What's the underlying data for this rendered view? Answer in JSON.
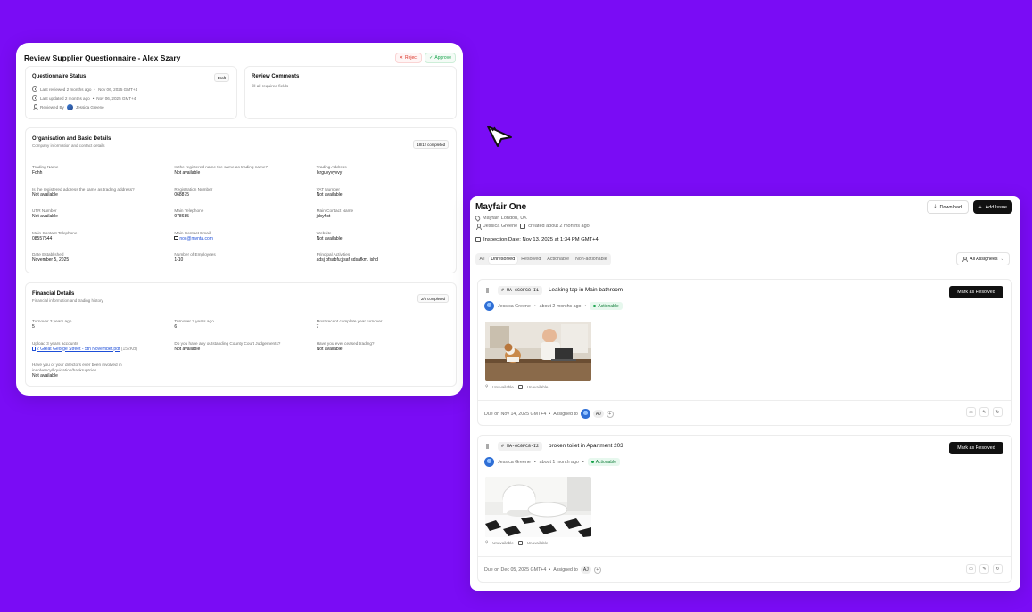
{
  "supplier_review": {
    "title": "Review Supplier Questionnaire - Alex Szary",
    "reject_label": "Reject",
    "approve_label": "Approve",
    "status_card": {
      "title": "Questionnaire Status",
      "badge": "Draft",
      "last_reviewed": "Last reviewed 2 months ago",
      "last_reviewed_date": "Nov 06, 2025 GMT+4",
      "last_updated": "Last updated 2 months ago",
      "last_updated_date": "Nov 06, 2025 GMT+4",
      "reviewed_by_label": "Reviewed By",
      "reviewer": "Jessica Greene"
    },
    "comments_card": {
      "title": "Review Comments",
      "text": "fill all required fields"
    },
    "org_section": {
      "title": "Organisation and Basic Details",
      "subtitle": "Company information and contact details",
      "badge": "18/12 completed",
      "fields": [
        {
          "label": "Trading Name",
          "value": "Fdhh"
        },
        {
          "label": "Is the registered name the same as trading name?",
          "value": "Not available"
        },
        {
          "label": "Trading Address",
          "value": "Ikrguvyvyvvy"
        },
        {
          "label": "Is the registered address the same as trading address?",
          "value": "Not available"
        },
        {
          "label": "Registration Number",
          "value": "068875"
        },
        {
          "label": "VAT Number",
          "value": "Not available"
        },
        {
          "label": "UTR Number",
          "value": "Not available"
        },
        {
          "label": "Main Telephone",
          "value": "978685"
        },
        {
          "label": "Main Contact Name",
          "value": "jkbyftct"
        },
        {
          "label": "Main Contact Telephone",
          "value": "08557544"
        },
        {
          "label": "Main Contact Email",
          "value": "noc@mvnta.com"
        },
        {
          "label": "Website",
          "value": "Not available"
        },
        {
          "label": "Date Established",
          "value": "November 5, 2025"
        },
        {
          "label": "Number of Employees",
          "value": "1-10"
        },
        {
          "label": "Principal Activities",
          "value": "adsj bfsabfu;jlsaf sdsafkm. ishd"
        }
      ]
    },
    "fin_section": {
      "title": "Financial Details",
      "subtitle": "Financial information and trading history",
      "badge": "2/6 completed",
      "fields": [
        {
          "label": "Turnover 3 years ago",
          "value": "5"
        },
        {
          "label": "Turnover 2 years ago",
          "value": "6"
        },
        {
          "label": "Most recent complete year turnover",
          "value": "7"
        },
        {
          "label": "Upload 3 years accounts",
          "value": "2 Great George Street - 5th November.pdf",
          "extra": "(152KB)"
        },
        {
          "label": "Do you have any outstanding County Court Judgements?",
          "value": "Not available"
        },
        {
          "label": "Have you ever ceased trading?",
          "value": "Not available"
        },
        {
          "label": "Have you or your directors ever been involved in insolvency/liquidation/bankruptcies",
          "value": "Not available"
        }
      ]
    }
  },
  "inspection": {
    "title": "Mayfair One",
    "location": "Mayfair, London, UK",
    "created_by": "Jessica Greene",
    "created_ago": "created about 2 months ago",
    "inspection_date": "Inspection Date: Nov 13, 2025 at 1:34 PM GMT+4",
    "download_label": "Download",
    "add_issue_label": "Add Issue",
    "tabs": [
      "All",
      "Unresolved",
      "Resolved",
      "Actionable",
      "Non-actionable"
    ],
    "active_tab": "Unresolved",
    "assignees_label": "All Assignees",
    "issues": [
      {
        "id": "# MA-6C0FC8-I1",
        "title": "Leaking tap in Main bathroom",
        "mark_label": "Mark as Resolved",
        "author": "Jessica Greene",
        "ago": "about 2 months ago",
        "status": "Actionable",
        "photo_loc": "Unavailable",
        "photo_date": "Unavailable",
        "due": "Due on Nov 14, 2025 GMT+4",
        "assigned_label": "Assigned to",
        "assignee": "AJ"
      },
      {
        "id": "# MA-6C0FC8-I2",
        "title": "broken toilet in Apartment 203",
        "mark_label": "Mark as Resolved",
        "author": "Jessica Greene",
        "ago": "about 1 month ago",
        "status": "Actionable",
        "photo_loc": "Unavailable",
        "photo_date": "Unavailable",
        "due": "Due on Dec 05, 2025 GMT+4",
        "assigned_label": "Assigned to",
        "assignee": "AJ"
      }
    ]
  },
  "colors": {
    "background": "#7a0cf5",
    "primary_button": "#111111",
    "actionable_green": "#16a34a",
    "reject_red": "#d92d20"
  }
}
